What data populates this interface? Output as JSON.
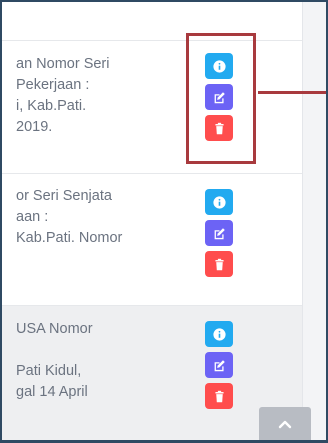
{
  "rows": [
    {
      "lines": [
        "an Nomor Seri",
        "Pekerjaan :",
        "i, Kab.Pati.",
        "2019."
      ],
      "shaded": false
    },
    {
      "lines": [
        "or Seri Senjata",
        "aan :",
        "Kab.Pati. Nomor",
        ""
      ],
      "shaded": false
    },
    {
      "lines": [
        "USA Nomor",
        "",
        "Pati Kidul,",
        "gal 14 April"
      ],
      "shaded": true
    }
  ],
  "actions": {
    "info_icon": "info-icon",
    "edit_icon": "edit-icon",
    "delete_icon": "trash-icon"
  },
  "colors": {
    "info": "#22aaf0",
    "edit": "#6c63f5",
    "delete": "#ff4d4d",
    "highlight": "#a83a3e",
    "scroll_button": "#b8bcc3"
  },
  "scroll_top_icon": "chevron-up-icon"
}
